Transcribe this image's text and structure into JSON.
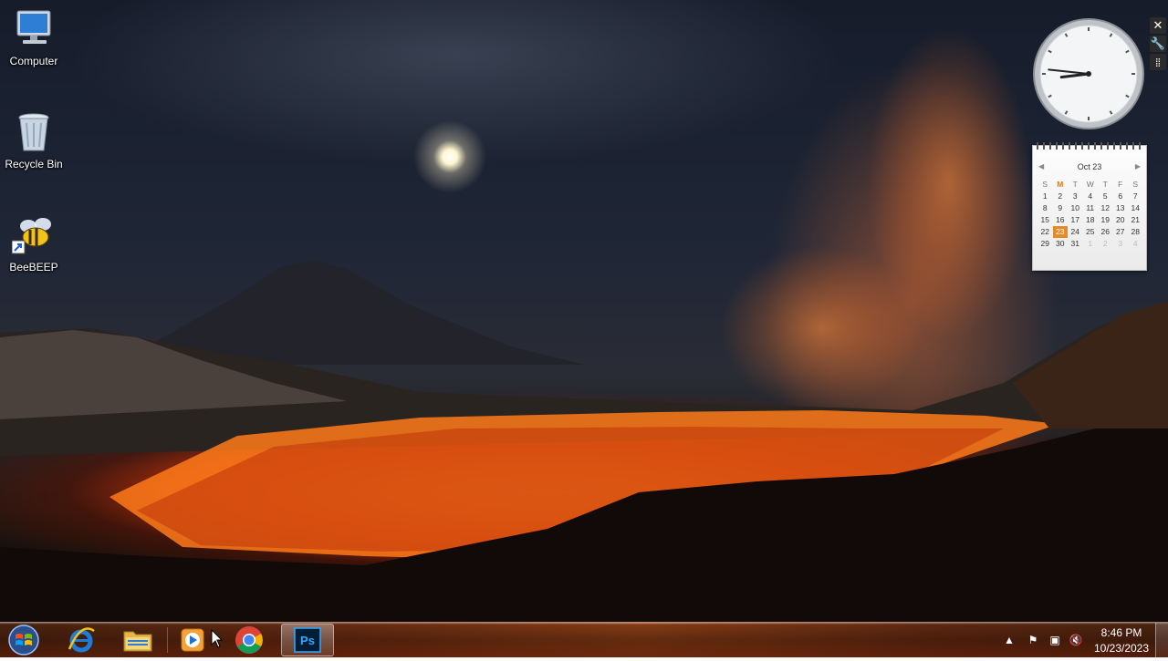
{
  "desktop": {
    "icons": [
      {
        "label": "Computer",
        "icon": "computer-icon"
      },
      {
        "label": "Recycle Bin",
        "icon": "recycle-bin-icon"
      },
      {
        "label": "BeeBEEP",
        "icon": "beebeep-icon"
      }
    ]
  },
  "gadgets": {
    "clock": {
      "time": "8:46"
    },
    "calendar": {
      "month_label": "Oct 23",
      "weekdays": [
        "S",
        "M",
        "T",
        "W",
        "T",
        "F",
        "S"
      ],
      "today_weekday_index": 1,
      "today": 23,
      "days": [
        [
          1,
          2,
          3,
          4,
          5,
          6,
          7
        ],
        [
          8,
          9,
          10,
          11,
          12,
          13,
          14
        ],
        [
          15,
          16,
          17,
          18,
          19,
          20,
          21
        ],
        [
          22,
          23,
          24,
          25,
          26,
          27,
          28
        ],
        [
          29,
          30,
          31,
          1,
          2,
          3,
          4
        ]
      ],
      "other_month_from": {
        "row": 4,
        "col": 3
      }
    }
  },
  "taskbar": {
    "items": [
      {
        "name": "internet-explorer",
        "icon": "internet-explorer-icon"
      },
      {
        "name": "windows-explorer",
        "icon": "folder-icon"
      },
      {
        "name": "media-player",
        "icon": "media-player-icon"
      },
      {
        "name": "chrome",
        "icon": "chrome-icon"
      },
      {
        "name": "photoshop",
        "icon": "photoshop-icon",
        "label": "Ps",
        "active": true
      }
    ],
    "tray": {
      "time": "8:46 PM",
      "date": "10/23/2023",
      "icons": [
        "show-hidden-icons",
        "action-center-icon",
        "network-icon",
        "volume-muted-icon"
      ]
    }
  },
  "colors": {
    "lava": "#ff7a1a",
    "calendar_today": "#e58a2a",
    "photoshop_blue": "#31a8ff"
  }
}
